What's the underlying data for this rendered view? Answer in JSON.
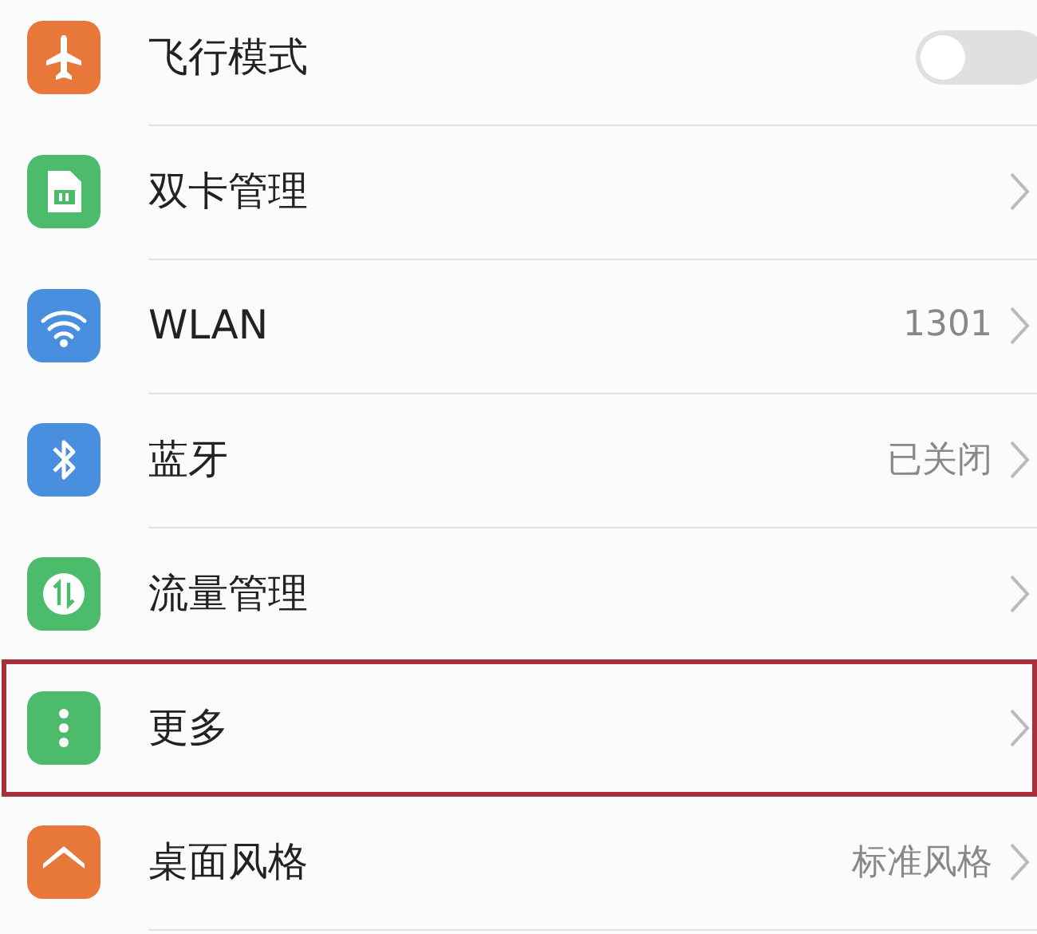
{
  "settings": [
    {
      "kind": "toggle",
      "label": "飞行模式",
      "on": false,
      "highlighted": false
    },
    {
      "kind": "link",
      "label": "双卡管理",
      "highlighted": false
    },
    {
      "kind": "link",
      "label": "WLAN",
      "value": "1301",
      "highlighted": false
    },
    {
      "kind": "link",
      "label": "蓝牙",
      "value": "已关闭",
      "highlighted": false
    },
    {
      "kind": "link",
      "label": "流量管理",
      "highlighted": false
    },
    {
      "kind": "link",
      "label": "更多",
      "highlighted": true
    },
    {
      "kind": "link",
      "label": "桌面风格",
      "value": "标准风格",
      "highlighted": false
    }
  ]
}
